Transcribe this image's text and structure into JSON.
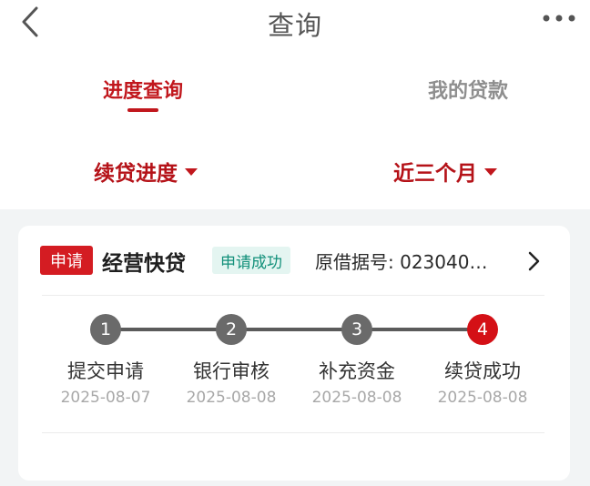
{
  "nav": {
    "title": "查询"
  },
  "tabs": [
    {
      "label": "进度查询",
      "active": true
    },
    {
      "label": "我的贷款",
      "active": false
    }
  ],
  "filters": {
    "type": "续贷进度",
    "period": "近三个月"
  },
  "card": {
    "tag": "申请",
    "product": "经营快贷",
    "status": "申请成功",
    "reference": "原借据号: 023040…",
    "steps": [
      {
        "number": "1",
        "label": "提交申请",
        "date": "2025-08-07"
      },
      {
        "number": "2",
        "label": "银行审核",
        "date": "2025-08-08"
      },
      {
        "number": "3",
        "label": "补充资金",
        "date": "2025-08-08"
      },
      {
        "number": "4",
        "label": "续贷成功",
        "date": "2025-08-08"
      }
    ]
  },
  "colors": {
    "accent": "#c1171d",
    "status": "#12907a",
    "background": "#f2f4f5"
  }
}
